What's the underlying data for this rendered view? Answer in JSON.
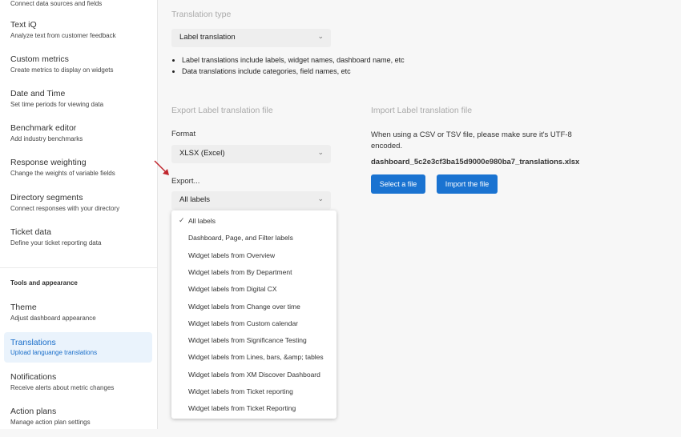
{
  "sidebar": {
    "items": [
      {
        "title": "",
        "subtitle": "Connect data sources and fields"
      },
      {
        "title": "Text iQ",
        "subtitle": "Analyze text from customer feedback"
      },
      {
        "title": "Custom metrics",
        "subtitle": "Create metrics to display on widgets"
      },
      {
        "title": "Date and Time",
        "subtitle": "Set time periods for viewing data"
      },
      {
        "title": "Benchmark editor",
        "subtitle": "Add industry benchmarks"
      },
      {
        "title": "Response weighting",
        "subtitle": "Change the weights of variable fields"
      },
      {
        "title": "Directory segments",
        "subtitle": "Connect responses with your directory"
      },
      {
        "title": "Ticket data",
        "subtitle": "Define your ticket reporting data"
      }
    ],
    "section_title": "Tools and appearance",
    "tools": [
      {
        "title": "Theme",
        "subtitle": "Adjust dashboard appearance"
      },
      {
        "title": "Translations",
        "subtitle": "Upload languange translations"
      },
      {
        "title": "Notifications",
        "subtitle": "Receive alerts about metric changes"
      },
      {
        "title": "Action plans",
        "subtitle": "Manage action plan settings"
      }
    ]
  },
  "main": {
    "translation_type_heading": "Translation type",
    "translation_type_value": "Label translation",
    "bullets": [
      "Label translations include labels, widget names, dashboard name, etc",
      "Data translations include categories, field names, etc"
    ],
    "export_heading": "Export Label translation file",
    "format_label": "Format",
    "format_value": "XLSX (Excel)",
    "export_label": "Export...",
    "export_value": "All labels",
    "export_options": [
      "All labels",
      "Dashboard, Page, and Filter labels",
      "Widget labels from Overview",
      "Widget labels from By Department",
      "Widget labels from Digital CX",
      "Widget labels from Change over time",
      "Widget labels from Custom calendar",
      "Widget labels from Significance Testing",
      "Widget labels from Lines, bars, &amp; tables",
      "Widget labels from XM Discover Dashboard",
      "Widget labels from Ticket reporting",
      "Widget labels from Ticket Reporting"
    ],
    "import_heading": "Import Label translation file",
    "import_note": "When using a CSV or TSV file, please make sure it's UTF-8 encoded.",
    "filename": "dashboard_5c2e3cf3ba15d9000e980ba7_translations.xlsx",
    "select_file": "Select a file",
    "import_file": "Import the file"
  },
  "colors": {
    "accent": "#1a73d1",
    "active_bg": "#eaf3fc",
    "arrow": "#c0262d"
  }
}
